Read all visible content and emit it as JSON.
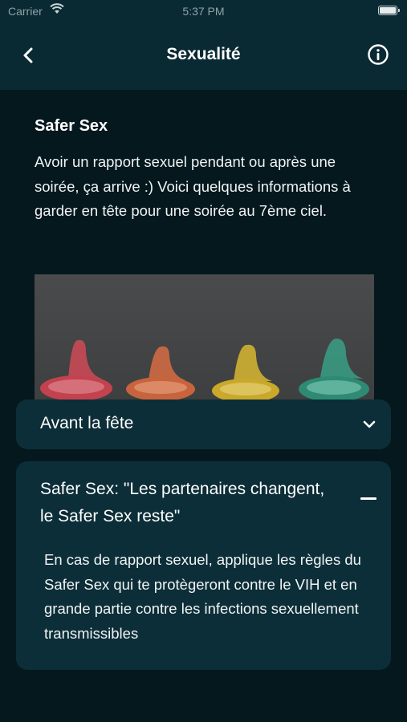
{
  "status_bar": {
    "carrier": "Carrier",
    "time": "5:37 PM"
  },
  "nav": {
    "title": "Sexualité",
    "back_icon": "chevron-left-icon",
    "info_icon": "info-circle-icon"
  },
  "intro": {
    "title": "Safer Sex",
    "text": "Avoir un rapport sexuel pendant ou après une soirée, ça arrive :) Voici quelques informations à garder en tête pour une soirée au 7ème ciel."
  },
  "accordion": [
    {
      "label": "Avant la fête",
      "expanded": false,
      "icon": "chevron-down-icon"
    },
    {
      "label": "Safer Sex:  \"Les partenaires changent, le Safer Sex reste\"",
      "expanded": true,
      "icon": "minus-icon",
      "body": "En cas de rapport sexuel, applique les règles du Safer Sex qui te protègeront contre le VIH et en grande partie contre les infections sexuellement transmissibles"
    }
  ],
  "colors": {
    "background": "#04181e",
    "nav_background": "#0a2a33",
    "card_background": "#0c2e38"
  }
}
